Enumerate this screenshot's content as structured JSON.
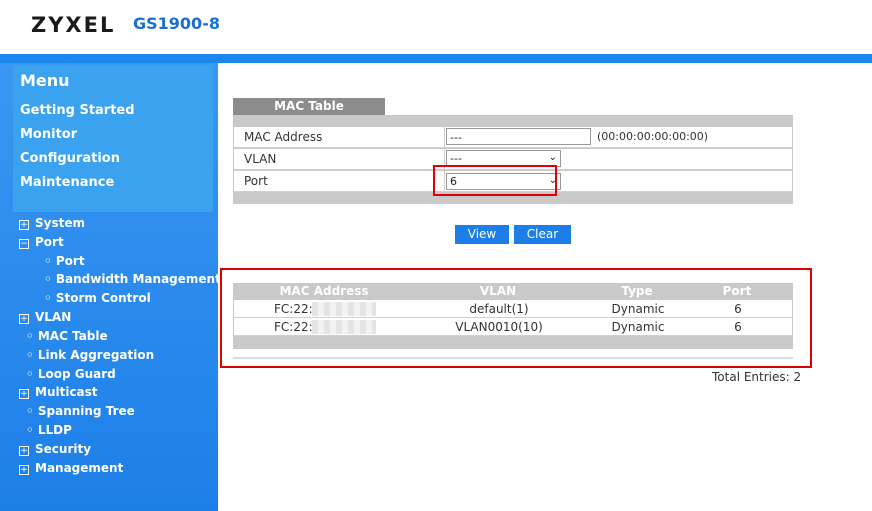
{
  "header": {
    "brand": "ZYXEL",
    "model": "GS1900-8"
  },
  "menu": {
    "title": "Menu",
    "items": [
      "Getting Started",
      "Monitor",
      "Configuration",
      "Maintenance"
    ]
  },
  "tree": {
    "system": "System",
    "port": "Port",
    "port_sub": [
      "Port",
      "Bandwidth Management",
      "Storm Control"
    ],
    "vlan": "VLAN",
    "mac_table": "MAC Table",
    "link_aggregation": "Link Aggregation",
    "loop_guard": "Loop Guard",
    "multicast": "Multicast",
    "spanning_tree": "Spanning Tree",
    "lldp": "LLDP",
    "security": "Security",
    "management": "Management"
  },
  "form": {
    "tab": "MAC Table",
    "mac_label": "MAC Address",
    "mac_value": "---",
    "mac_hint": "(00:00:00:00:00:00)",
    "vlan_label": "VLAN",
    "vlan_value": "---",
    "port_label": "Port",
    "port_value": "6",
    "view_button": "View",
    "clear_button": "Clear"
  },
  "table": {
    "columns": [
      "MAC Address",
      "VLAN",
      "Type",
      "Port"
    ],
    "rows": [
      {
        "mac": "FC:22:F",
        "vlan": "default(1)",
        "type": "Dynamic",
        "port": "6"
      },
      {
        "mac": "FC:22:F",
        "vlan": "VLAN0010(10)",
        "type": "Dynamic",
        "port": "6"
      }
    ],
    "total": "Total Entries: 2"
  },
  "colors": {
    "accent": "#1c87f0",
    "highlight": "#e00000",
    "tab": "#8c8c8c"
  }
}
